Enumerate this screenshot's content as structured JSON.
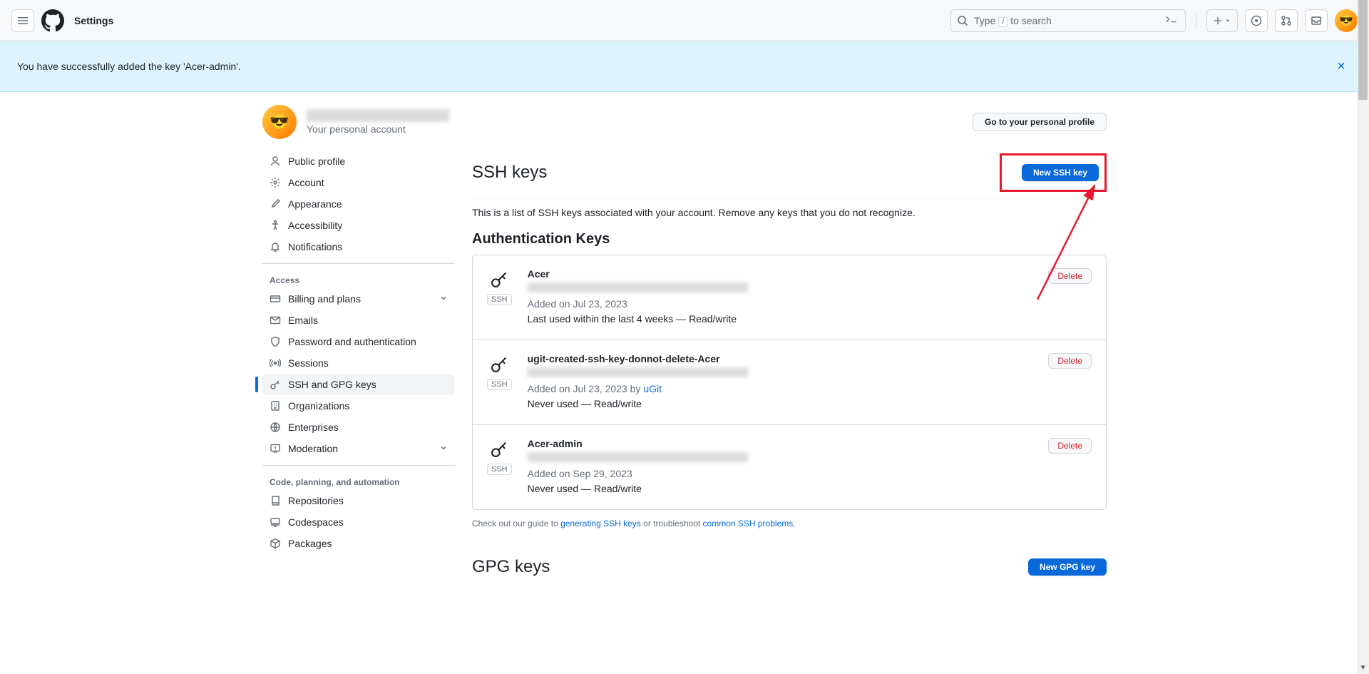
{
  "header": {
    "page_label": "Settings",
    "search_prefix": "Type ",
    "search_key": "/",
    "search_suffix": " to search"
  },
  "flash": {
    "message": "You have successfully added the key 'Acer-admin'."
  },
  "profile": {
    "subtitle": "Your personal account",
    "go_to_profile": "Go to your personal profile"
  },
  "sidebar": {
    "items": [
      {
        "label": "Public profile"
      },
      {
        "label": "Account"
      },
      {
        "label": "Appearance"
      },
      {
        "label": "Accessibility"
      },
      {
        "label": "Notifications"
      }
    ],
    "access_header": "Access",
    "access_items": [
      {
        "label": "Billing and plans",
        "chevron": true
      },
      {
        "label": "Emails"
      },
      {
        "label": "Password and authentication"
      },
      {
        "label": "Sessions"
      },
      {
        "label": "SSH and GPG keys",
        "active": true
      },
      {
        "label": "Organizations"
      },
      {
        "label": "Enterprises"
      },
      {
        "label": "Moderation",
        "chevron": true
      }
    ],
    "code_header": "Code, planning, and automation",
    "code_items": [
      {
        "label": "Repositories"
      },
      {
        "label": "Codespaces"
      },
      {
        "label": "Packages"
      }
    ]
  },
  "ssh": {
    "title": "SSH keys",
    "new_btn": "New SSH key",
    "desc": "This is a list of SSH keys associated with your account. Remove any keys that you do not recognize.",
    "auth_title": "Authentication Keys",
    "badge": "SSH",
    "delete_btn": "Delete",
    "keys": [
      {
        "name": "Acer",
        "added": "Added on Jul 23, 2023",
        "usage": "Last used within the last 4 weeks — Read/write"
      },
      {
        "name": "ugit-created-ssh-key-donnot-delete-Acer",
        "added_prefix": "Added on Jul 23, 2023 by ",
        "added_tool": "uGit",
        "usage": "Never used — Read/write"
      },
      {
        "name": "Acer-admin",
        "added": "Added on Sep 29, 2023",
        "usage": "Never used — Read/write"
      }
    ],
    "footer_pre": "Check out our guide to ",
    "footer_link1": "generating SSH keys",
    "footer_mid": " or troubleshoot ",
    "footer_link2": "common SSH problems",
    "footer_end": "."
  },
  "gpg": {
    "title": "GPG keys",
    "new_btn": "New GPG key"
  }
}
